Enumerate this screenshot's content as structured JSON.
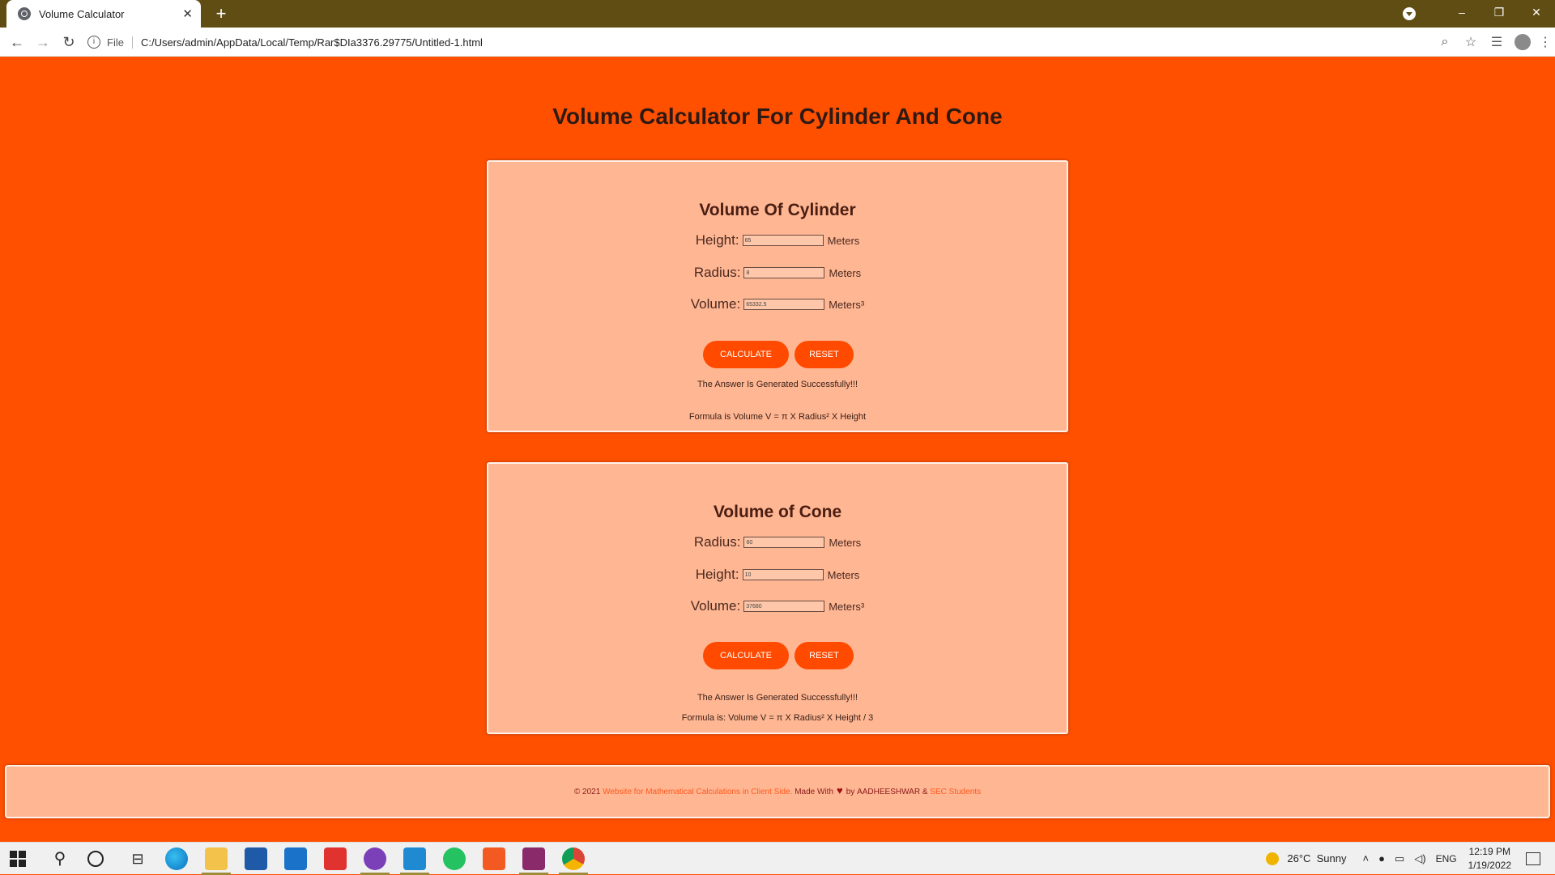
{
  "browser": {
    "tab_title": "Volume Calculator",
    "tab_close": "✕",
    "new_tab": "+",
    "scheme": "File",
    "url": "C:/Users/admin/AppData/Local/Temp/Rar$DIa3376.29775/Untitled-1.html",
    "window_controls": {
      "minimize": "–",
      "restore": "❐",
      "close": "✕"
    }
  },
  "page": {
    "title": "Volume Calculator For Cylinder And Cone"
  },
  "cylinder": {
    "heading": "Volume Of Cylinder",
    "height_label": "Height:",
    "height_value": "65",
    "height_unit": "Meters",
    "radius_label": "Radius:",
    "radius_value": "8",
    "radius_unit": "Meters",
    "volume_label": "Volume:",
    "volume_value": "65332.5",
    "volume_unit": "Meters³",
    "calculate_label": "CALCULATE",
    "reset_label": "RESET",
    "status": "The Answer Is Generated Successfully!!!",
    "formula": "Formula is Volume V = π X Radius² X Height"
  },
  "cone": {
    "heading": "Volume of Cone",
    "radius_label": "Radius:",
    "radius_value": "60",
    "radius_unit": "Meters",
    "height_label": "Height:",
    "height_value": "10",
    "height_unit": "Meters",
    "volume_label": "Volume:",
    "volume_value": "37680",
    "volume_unit": "Meters³",
    "calculate_label": "CALCULATE",
    "reset_label": "RESET",
    "status": "The Answer Is Generated Successfully!!!",
    "formula": "Formula is: Volume V = π X Radius² X Height / 3"
  },
  "footer": {
    "copyright": "© 2021",
    "site_link": "Website for Mathematical Calculations in Client Side.",
    "made_with": "Made With",
    "heart": "♥",
    "by": "by",
    "author": "AADHEESHWAR",
    "amp": "&",
    "org_link": "SEC Students"
  },
  "taskbar": {
    "weather_temp": "26°C",
    "weather_desc": "Sunny",
    "lang": "ENG",
    "time": "12:19 PM",
    "date": "1/19/2022"
  },
  "colors": {
    "page_bg": "#ff5000",
    "card_bg": "#ffb693",
    "button": "#ff4a00",
    "tabbar": "#5f4d14"
  }
}
